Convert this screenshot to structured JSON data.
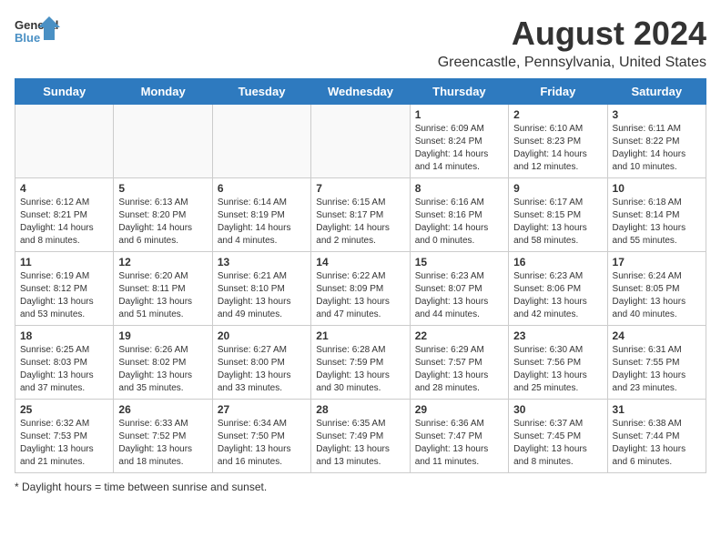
{
  "header": {
    "logo_general": "General",
    "logo_blue": "Blue",
    "month_year": "August 2024",
    "location": "Greencastle, Pennsylvania, United States"
  },
  "days_of_week": [
    "Sunday",
    "Monday",
    "Tuesday",
    "Wednesday",
    "Thursday",
    "Friday",
    "Saturday"
  ],
  "footer": {
    "note": "Daylight hours"
  },
  "weeks": [
    {
      "days": [
        {
          "num": "",
          "empty": true
        },
        {
          "num": "",
          "empty": true
        },
        {
          "num": "",
          "empty": true
        },
        {
          "num": "",
          "empty": true
        },
        {
          "num": "1",
          "sunrise": "Sunrise: 6:09 AM",
          "sunset": "Sunset: 8:24 PM",
          "daylight": "Daylight: 14 hours and 14 minutes."
        },
        {
          "num": "2",
          "sunrise": "Sunrise: 6:10 AM",
          "sunset": "Sunset: 8:23 PM",
          "daylight": "Daylight: 14 hours and 12 minutes."
        },
        {
          "num": "3",
          "sunrise": "Sunrise: 6:11 AM",
          "sunset": "Sunset: 8:22 PM",
          "daylight": "Daylight: 14 hours and 10 minutes."
        }
      ]
    },
    {
      "days": [
        {
          "num": "4",
          "sunrise": "Sunrise: 6:12 AM",
          "sunset": "Sunset: 8:21 PM",
          "daylight": "Daylight: 14 hours and 8 minutes."
        },
        {
          "num": "5",
          "sunrise": "Sunrise: 6:13 AM",
          "sunset": "Sunset: 8:20 PM",
          "daylight": "Daylight: 14 hours and 6 minutes."
        },
        {
          "num": "6",
          "sunrise": "Sunrise: 6:14 AM",
          "sunset": "Sunset: 8:19 PM",
          "daylight": "Daylight: 14 hours and 4 minutes."
        },
        {
          "num": "7",
          "sunrise": "Sunrise: 6:15 AM",
          "sunset": "Sunset: 8:17 PM",
          "daylight": "Daylight: 14 hours and 2 minutes."
        },
        {
          "num": "8",
          "sunrise": "Sunrise: 6:16 AM",
          "sunset": "Sunset: 8:16 PM",
          "daylight": "Daylight: 14 hours and 0 minutes."
        },
        {
          "num": "9",
          "sunrise": "Sunrise: 6:17 AM",
          "sunset": "Sunset: 8:15 PM",
          "daylight": "Daylight: 13 hours and 58 minutes."
        },
        {
          "num": "10",
          "sunrise": "Sunrise: 6:18 AM",
          "sunset": "Sunset: 8:14 PM",
          "daylight": "Daylight: 13 hours and 55 minutes."
        }
      ]
    },
    {
      "days": [
        {
          "num": "11",
          "sunrise": "Sunrise: 6:19 AM",
          "sunset": "Sunset: 8:12 PM",
          "daylight": "Daylight: 13 hours and 53 minutes."
        },
        {
          "num": "12",
          "sunrise": "Sunrise: 6:20 AM",
          "sunset": "Sunset: 8:11 PM",
          "daylight": "Daylight: 13 hours and 51 minutes."
        },
        {
          "num": "13",
          "sunrise": "Sunrise: 6:21 AM",
          "sunset": "Sunset: 8:10 PM",
          "daylight": "Daylight: 13 hours and 49 minutes."
        },
        {
          "num": "14",
          "sunrise": "Sunrise: 6:22 AM",
          "sunset": "Sunset: 8:09 PM",
          "daylight": "Daylight: 13 hours and 47 minutes."
        },
        {
          "num": "15",
          "sunrise": "Sunrise: 6:23 AM",
          "sunset": "Sunset: 8:07 PM",
          "daylight": "Daylight: 13 hours and 44 minutes."
        },
        {
          "num": "16",
          "sunrise": "Sunrise: 6:23 AM",
          "sunset": "Sunset: 8:06 PM",
          "daylight": "Daylight: 13 hours and 42 minutes."
        },
        {
          "num": "17",
          "sunrise": "Sunrise: 6:24 AM",
          "sunset": "Sunset: 8:05 PM",
          "daylight": "Daylight: 13 hours and 40 minutes."
        }
      ]
    },
    {
      "days": [
        {
          "num": "18",
          "sunrise": "Sunrise: 6:25 AM",
          "sunset": "Sunset: 8:03 PM",
          "daylight": "Daylight: 13 hours and 37 minutes."
        },
        {
          "num": "19",
          "sunrise": "Sunrise: 6:26 AM",
          "sunset": "Sunset: 8:02 PM",
          "daylight": "Daylight: 13 hours and 35 minutes."
        },
        {
          "num": "20",
          "sunrise": "Sunrise: 6:27 AM",
          "sunset": "Sunset: 8:00 PM",
          "daylight": "Daylight: 13 hours and 33 minutes."
        },
        {
          "num": "21",
          "sunrise": "Sunrise: 6:28 AM",
          "sunset": "Sunset: 7:59 PM",
          "daylight": "Daylight: 13 hours and 30 minutes."
        },
        {
          "num": "22",
          "sunrise": "Sunrise: 6:29 AM",
          "sunset": "Sunset: 7:57 PM",
          "daylight": "Daylight: 13 hours and 28 minutes."
        },
        {
          "num": "23",
          "sunrise": "Sunrise: 6:30 AM",
          "sunset": "Sunset: 7:56 PM",
          "daylight": "Daylight: 13 hours and 25 minutes."
        },
        {
          "num": "24",
          "sunrise": "Sunrise: 6:31 AM",
          "sunset": "Sunset: 7:55 PM",
          "daylight": "Daylight: 13 hours and 23 minutes."
        }
      ]
    },
    {
      "days": [
        {
          "num": "25",
          "sunrise": "Sunrise: 6:32 AM",
          "sunset": "Sunset: 7:53 PM",
          "daylight": "Daylight: 13 hours and 21 minutes."
        },
        {
          "num": "26",
          "sunrise": "Sunrise: 6:33 AM",
          "sunset": "Sunset: 7:52 PM",
          "daylight": "Daylight: 13 hours and 18 minutes."
        },
        {
          "num": "27",
          "sunrise": "Sunrise: 6:34 AM",
          "sunset": "Sunset: 7:50 PM",
          "daylight": "Daylight: 13 hours and 16 minutes."
        },
        {
          "num": "28",
          "sunrise": "Sunrise: 6:35 AM",
          "sunset": "Sunset: 7:49 PM",
          "daylight": "Daylight: 13 hours and 13 minutes."
        },
        {
          "num": "29",
          "sunrise": "Sunrise: 6:36 AM",
          "sunset": "Sunset: 7:47 PM",
          "daylight": "Daylight: 13 hours and 11 minutes."
        },
        {
          "num": "30",
          "sunrise": "Sunrise: 6:37 AM",
          "sunset": "Sunset: 7:45 PM",
          "daylight": "Daylight: 13 hours and 8 minutes."
        },
        {
          "num": "31",
          "sunrise": "Sunrise: 6:38 AM",
          "sunset": "Sunset: 7:44 PM",
          "daylight": "Daylight: 13 hours and 6 minutes."
        }
      ]
    }
  ]
}
